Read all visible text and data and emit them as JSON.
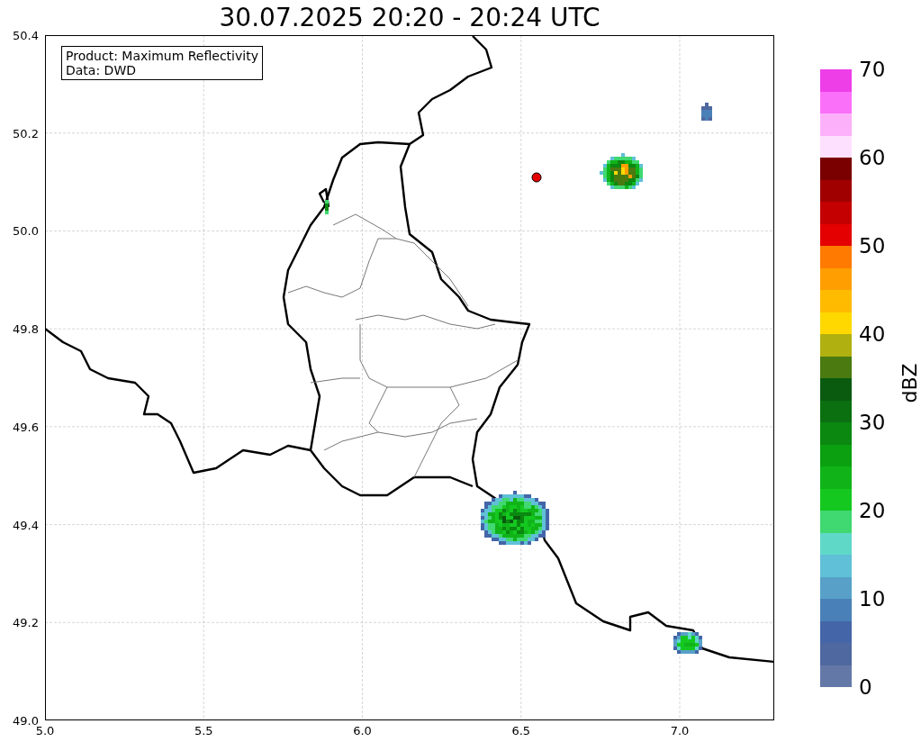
{
  "title": "30.07.2025 20:20 - 20:24 UTC",
  "legend": [
    "Product: Maximum Reflectivity",
    "Data: DWD"
  ],
  "x_ticks": [
    "5.0",
    "5.5",
    "6.0",
    "6.5",
    "7.0"
  ],
  "y_ticks": [
    "50.4",
    "50.2",
    "50.0",
    "49.8",
    "49.6",
    "49.4",
    "49.2",
    "49.0"
  ],
  "colorbar": {
    "ticks": [
      "70",
      "60",
      "50",
      "40",
      "30",
      "20",
      "10",
      "0"
    ],
    "segments": [
      {
        "color": "#ee3ee8"
      },
      {
        "color": "#fa70f8"
      },
      {
        "color": "#fcb0fa"
      },
      {
        "color": "#fde0fd"
      },
      {
        "color": "#7a0000"
      },
      {
        "color": "#a00000"
      },
      {
        "color": "#c40000"
      },
      {
        "color": "#e40000"
      },
      {
        "color": "#ff7a00"
      },
      {
        "color": "#ff9e00"
      },
      {
        "color": "#ffbb00"
      },
      {
        "color": "#ffd800"
      },
      {
        "color": "#b0b010"
      },
      {
        "color": "#4a7a10"
      },
      {
        "color": "#0a5a10"
      },
      {
        "color": "#0a7010"
      },
      {
        "color": "#0a8810"
      },
      {
        "color": "#0aa010"
      },
      {
        "color": "#10b418"
      },
      {
        "color": "#14c820"
      },
      {
        "color": "#40d870"
      },
      {
        "color": "#60d8c8"
      },
      {
        "color": "#60c0d8"
      },
      {
        "color": "#58a0c8"
      },
      {
        "color": "#4a80b8"
      },
      {
        "color": "#4466a8"
      },
      {
        "color": "#5068a0"
      },
      {
        "color": "#6478a8"
      }
    ],
    "label": "dBZ"
  }
}
